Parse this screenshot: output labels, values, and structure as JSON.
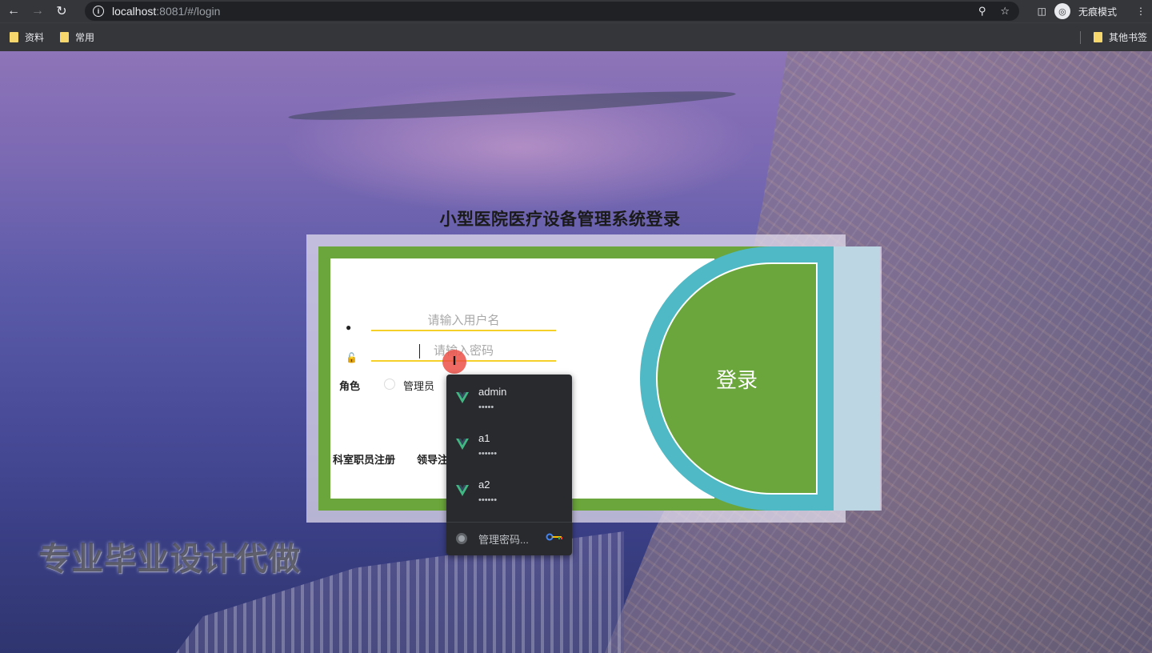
{
  "browser": {
    "url_host": "localhost",
    "url_rest": ":8081/#/login",
    "incognito_label": "无痕模式",
    "bookmarks": [
      "资料",
      "常用"
    ],
    "other_bookmarks": "其他书签"
  },
  "page": {
    "title": "小型医院医疗设备管理系统登录",
    "username_placeholder": "请输入用户名",
    "password_placeholder": "请输入密码",
    "role_label": "角色",
    "role_option": "管理员",
    "login_button": "登录",
    "register_links": [
      "科室职员注册",
      "领导注"
    ],
    "watermark": "专业毕业设计代做"
  },
  "password_popup": {
    "items": [
      {
        "username": "admin",
        "mask": "•••••"
      },
      {
        "username": "a1",
        "mask": "••••••"
      },
      {
        "username": "a2",
        "mask": "••••••"
      }
    ],
    "manage_label": "管理密码..."
  },
  "colors": {
    "frame_green": "#6aa63b",
    "login_ring": "#4fbac6",
    "input_underline": "#f5cf2a",
    "vue_green": "#41b883"
  }
}
